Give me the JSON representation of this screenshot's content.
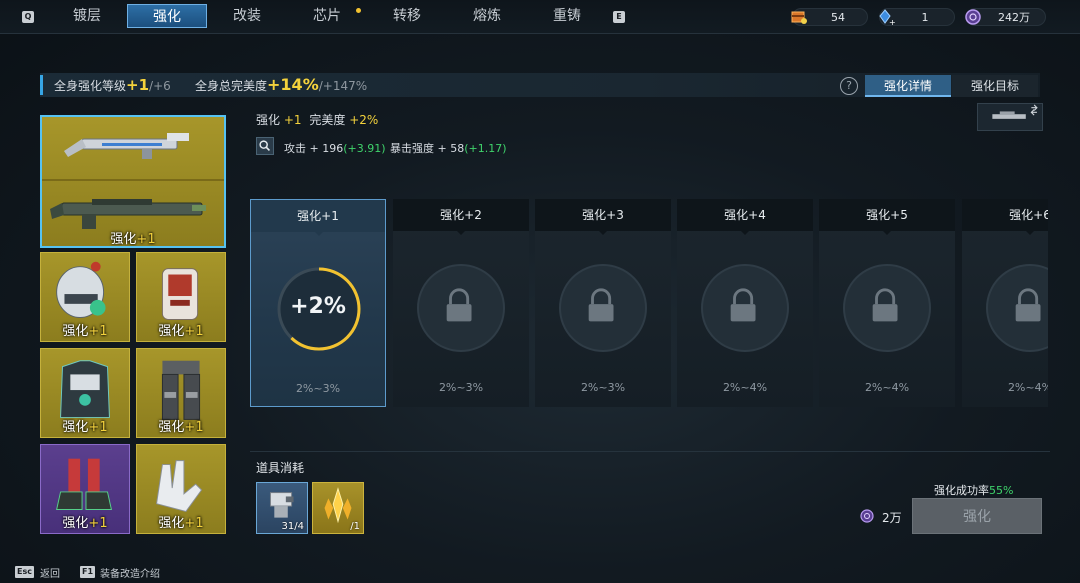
{
  "topbar": {
    "key_left": "Q",
    "key_right": "E",
    "tabs": [
      "镀层",
      "强化",
      "改装",
      "芯片",
      "转移",
      "熔炼",
      "重铸"
    ],
    "active_tab": "强化",
    "currencies": [
      {
        "icon": "orange-crate-icon",
        "value": "54"
      },
      {
        "icon": "blue-crystal-plus-icon",
        "value": "1"
      },
      {
        "icon": "purple-coin-icon",
        "value": "242万"
      }
    ]
  },
  "summary": {
    "level_label": "全身强化等级",
    "level_value": "+1",
    "level_max": "/+6",
    "perfection_label": "全身总完美度",
    "perfection_value": "+14%",
    "perfection_max": "/+147%"
  },
  "subtabs": [
    "强化详情",
    "强化目标"
  ],
  "equipment": [
    {
      "name": "weapon-primary",
      "label": "",
      "plus": "",
      "rarity": "gold"
    },
    {
      "name": "weapon-rifle",
      "label": "强化",
      "plus": "+1",
      "rarity": "gold"
    },
    {
      "name": "helmet",
      "label": "强化",
      "plus": "+1",
      "rarity": "gold"
    },
    {
      "name": "backpack",
      "label": "强化",
      "plus": "+1",
      "rarity": "gold"
    },
    {
      "name": "chest-armor",
      "label": "强化",
      "plus": "+1",
      "rarity": "gold"
    },
    {
      "name": "leg-armor",
      "label": "强化",
      "plus": "+1",
      "rarity": "gold"
    },
    {
      "name": "boots",
      "label": "强化",
      "plus": "+1",
      "rarity": "purple"
    },
    {
      "name": "gloves",
      "label": "强化",
      "plus": "+1",
      "rarity": "gold"
    }
  ],
  "details": {
    "enhance_label": "强化",
    "enhance_value": "+1",
    "perfection_label": "完美度",
    "perfection_value": "+2%",
    "attack_label": "攻击 + 196",
    "attack_bonus": "(+3.91)",
    "crit_label": "暴击强度 + 58",
    "crit_bonus": "(+1.17)"
  },
  "levels": [
    {
      "title": "强化+1",
      "center": "+2%",
      "range": "2%~3%",
      "unlocked": true,
      "progress": 0.62
    },
    {
      "title": "强化+2",
      "center": "",
      "range": "2%~3%",
      "unlocked": false
    },
    {
      "title": "强化+3",
      "center": "",
      "range": "2%~3%",
      "unlocked": false
    },
    {
      "title": "强化+4",
      "center": "",
      "range": "2%~4%",
      "unlocked": false
    },
    {
      "title": "强化+5",
      "center": "",
      "range": "2%~4%",
      "unlocked": false
    },
    {
      "title": "强化+6",
      "center": "",
      "range": "2%~4%",
      "unlocked": false
    }
  ],
  "consumables": {
    "title": "道具消耗",
    "items": [
      {
        "icon": "metal-part-icon",
        "count": "31/4"
      },
      {
        "icon": "gold-crystal-icon",
        "count": "/1"
      }
    ]
  },
  "action": {
    "success_label": "强化成功率",
    "success_value": "55%",
    "cost": "2万",
    "button": "强化"
  },
  "footer": [
    {
      "key": "Esc",
      "label": "返回"
    },
    {
      "key": "F1",
      "label": "装备改造介绍"
    }
  ],
  "colors": {
    "accent_blue": "#37a6e6",
    "highlight_yellow": "#f4d23c",
    "bonus_green": "#3fd36b",
    "gold_rarity": "#a7962a",
    "purple_rarity": "#5b3f8e"
  }
}
